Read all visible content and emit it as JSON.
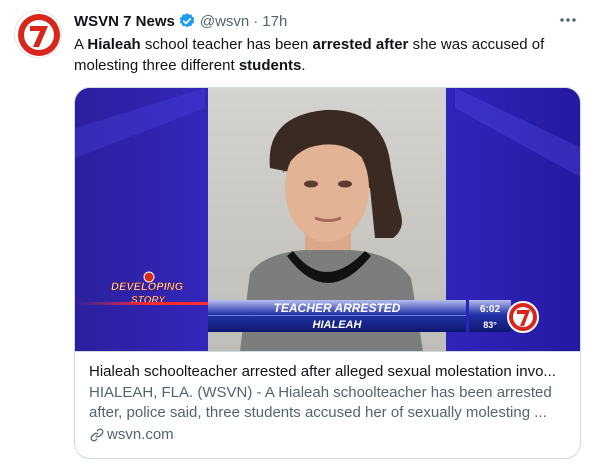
{
  "tweet": {
    "account_name": "WSVN 7 News",
    "handle": "@wsvn",
    "separator": "·",
    "time": "17h",
    "text_parts": [
      {
        "t": "A ",
        "bold": false
      },
      {
        "t": "Hialeah",
        "bold": true
      },
      {
        "t": " school teacher has been ",
        "bold": false
      },
      {
        "t": "arrested after",
        "bold": true
      },
      {
        "t": " she was accused of molesting three different ",
        "bold": false
      },
      {
        "t": "students",
        "bold": true
      },
      {
        "t": ".",
        "bold": false
      }
    ],
    "icons": {
      "avatar": "wsvn-7-logo",
      "verified": "verified-badge-icon",
      "more": "more-options-icon",
      "link": "link-icon"
    },
    "colors": {
      "verified": "#1d9bf0",
      "logo_red": "#d9261c"
    }
  },
  "card": {
    "broadcast": {
      "bug_line1": "DEVELOPING",
      "bug_line2": "STORY",
      "headline": "TEACHER ARRESTED",
      "subline": "HIALEAH",
      "clock": "6:02",
      "temperature": "83°"
    },
    "title": "Hialeah schoolteacher arrested after alleged sexual molestation invo...",
    "description": "HIALEAH, FLA. (WSVN) - A Hialeah schoolteacher has been arrested after, police said, three students accused her of sexually molesting ...",
    "domain": "wsvn.com"
  }
}
